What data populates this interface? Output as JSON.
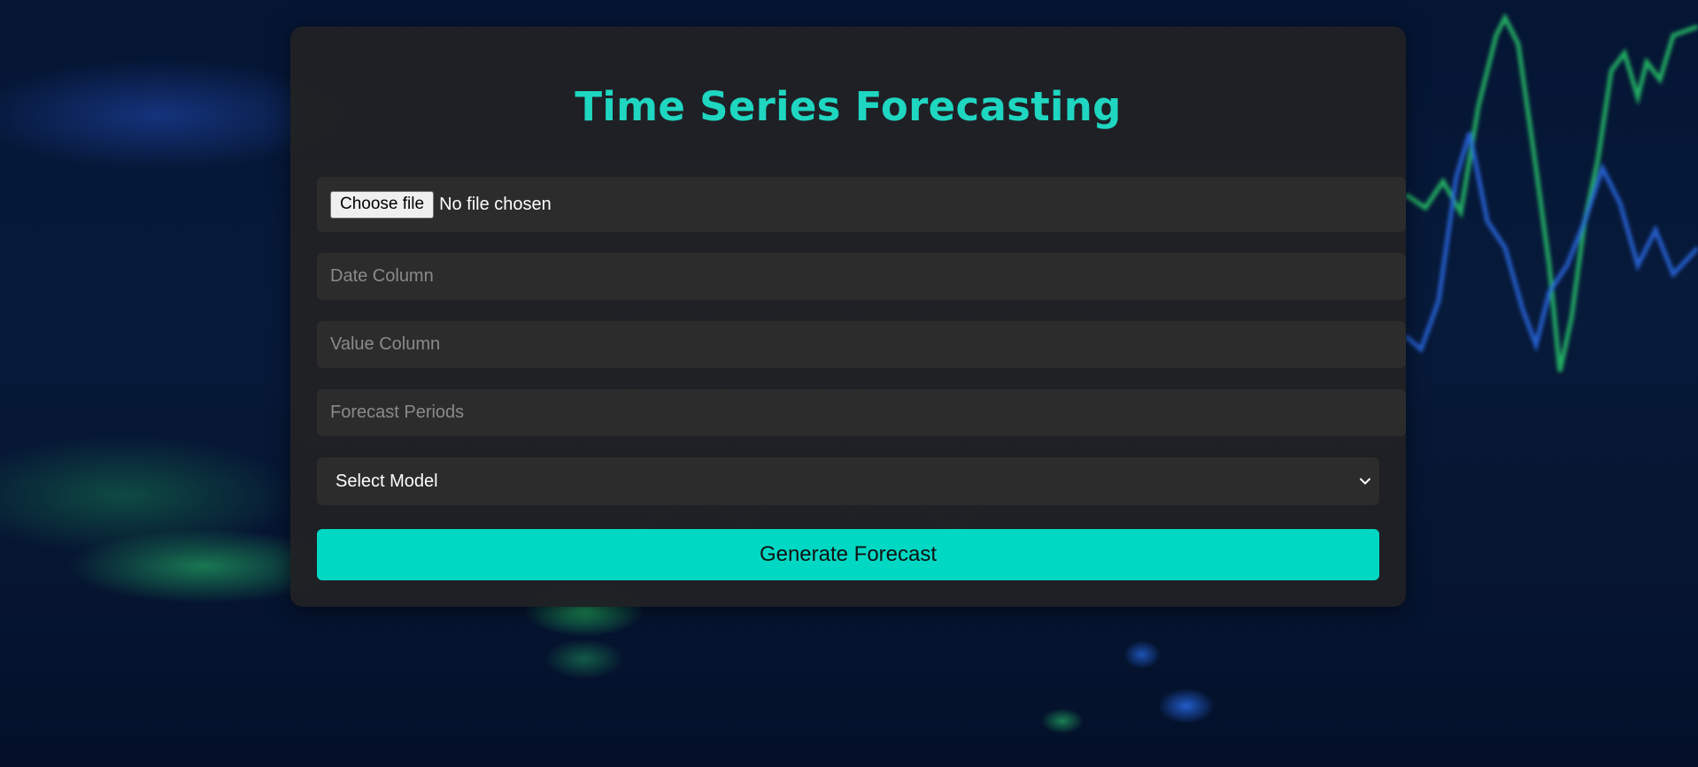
{
  "page": {
    "title": "Time Series Forecasting"
  },
  "form": {
    "file_button_label": "Choose file",
    "file_status": "No file chosen",
    "date_column": {
      "value": "",
      "placeholder": "Date Column"
    },
    "value_column": {
      "value": "",
      "placeholder": "Value Column"
    },
    "forecast_periods": {
      "value": "",
      "placeholder": "Forecast Periods"
    },
    "model_select": {
      "selected": "Select Model"
    },
    "submit_label": "Generate Forecast"
  },
  "icons": {
    "select_arrow": "chevron-down-icon"
  },
  "colors": {
    "accent": "#1fd6c1",
    "button": "#00d8c4",
    "card": "#202124",
    "field": "#2c2c2c",
    "background": "#061632"
  }
}
